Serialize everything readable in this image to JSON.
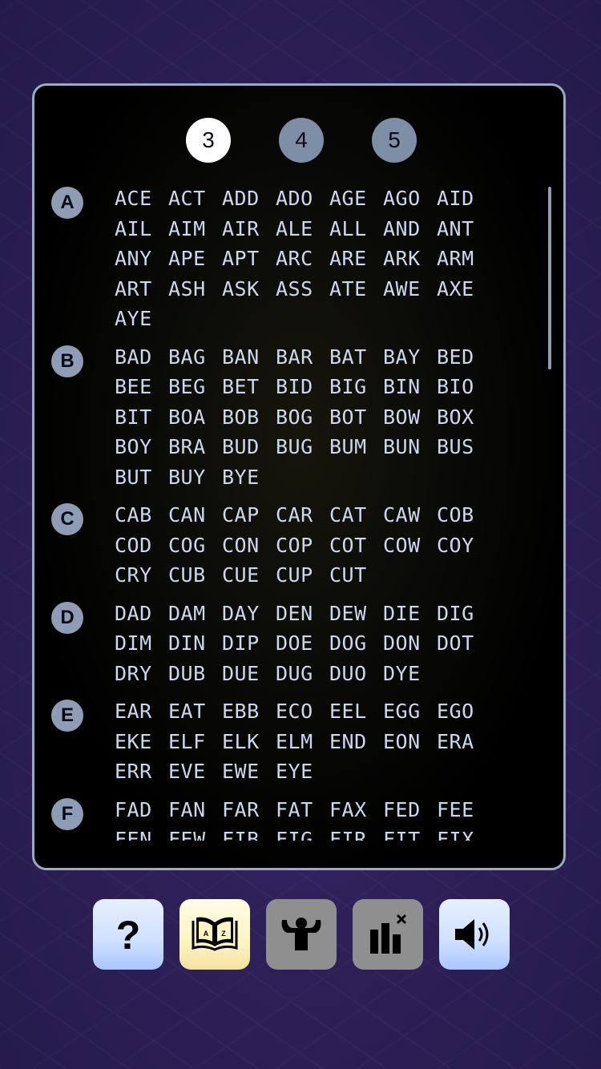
{
  "length_tabs": [
    {
      "label": "3",
      "active": true
    },
    {
      "label": "4",
      "active": false
    },
    {
      "label": "5",
      "active": false
    }
  ],
  "groups": [
    {
      "letter": "A",
      "words": [
        "ACE",
        "ACT",
        "ADD",
        "ADO",
        "AGE",
        "AGO",
        "AID",
        "AIL",
        "AIM",
        "AIR",
        "ALE",
        "ALL",
        "AND",
        "ANT",
        "ANY",
        "APE",
        "APT",
        "ARC",
        "ARE",
        "ARK",
        "ARM",
        "ART",
        "ASH",
        "ASK",
        "ASS",
        "ATE",
        "AWE",
        "AXE",
        "AYE"
      ]
    },
    {
      "letter": "B",
      "words": [
        "BAD",
        "BAG",
        "BAN",
        "BAR",
        "BAT",
        "BAY",
        "BED",
        "BEE",
        "BEG",
        "BET",
        "BID",
        "BIG",
        "BIN",
        "BIO",
        "BIT",
        "BOA",
        "BOB",
        "BOG",
        "BOT",
        "BOW",
        "BOX",
        "BOY",
        "BRA",
        "BUD",
        "BUG",
        "BUM",
        "BUN",
        "BUS",
        "BUT",
        "BUY",
        "BYE"
      ]
    },
    {
      "letter": "C",
      "words": [
        "CAB",
        "CAN",
        "CAP",
        "CAR",
        "CAT",
        "CAW",
        "COB",
        "COD",
        "COG",
        "CON",
        "COP",
        "COT",
        "COW",
        "COY",
        "CRY",
        "CUB",
        "CUE",
        "CUP",
        "CUT"
      ]
    },
    {
      "letter": "D",
      "words": [
        "DAD",
        "DAM",
        "DAY",
        "DEN",
        "DEW",
        "DIE",
        "DIG",
        "DIM",
        "DIN",
        "DIP",
        "DOE",
        "DOG",
        "DON",
        "DOT",
        "DRY",
        "DUB",
        "DUE",
        "DUG",
        "DUO",
        "DYE"
      ]
    },
    {
      "letter": "E",
      "words": [
        "EAR",
        "EAT",
        "EBB",
        "ECO",
        "EEL",
        "EGG",
        "EGO",
        "EKE",
        "ELF",
        "ELK",
        "ELM",
        "END",
        "EON",
        "ERA",
        "ERR",
        "EVE",
        "EWE",
        "EYE"
      ]
    },
    {
      "letter": "F",
      "words": [
        "FAD",
        "FAN",
        "FAR",
        "FAT",
        "FAX",
        "FED",
        "FEE",
        "FEN",
        "FEW",
        "FIB",
        "FIG",
        "FIR",
        "FIT",
        "FIX"
      ]
    }
  ],
  "toolbar": {
    "help_icon": "question-icon",
    "dictionary_icon": "book-az-icon",
    "stats_icon": "muscle-person-icon",
    "chart_icon": "bar-chart-close-icon",
    "sound_icon": "speaker-icon",
    "colors": {
      "help_bg": "#cfe0ff",
      "dictionary_bg": "#fff3c2",
      "disabled_bg": "#8f8f8f",
      "sound_bg": "#cfe0ff"
    }
  }
}
